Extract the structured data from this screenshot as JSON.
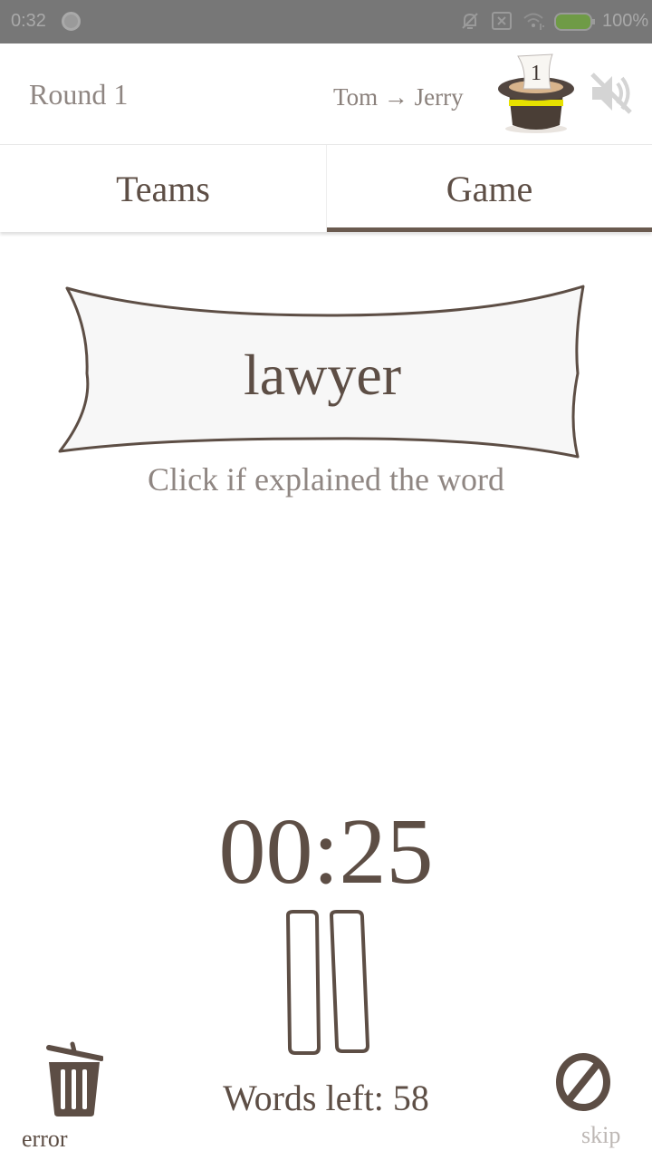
{
  "status_bar": {
    "time": "0:32",
    "battery": "100%",
    "icons": [
      "notification-dot-icon",
      "bell-off-icon",
      "sim-off-icon",
      "wifi-icon",
      "battery-charging-icon"
    ]
  },
  "header": {
    "round_label": "Round 1",
    "players": "Tom → Jerry",
    "hat_count": "1",
    "sound_icon": "volume-off-icon"
  },
  "tabs": [
    {
      "label": "Teams",
      "active": false
    },
    {
      "label": "Game",
      "active": true
    }
  ],
  "card": {
    "word": "lawyer",
    "hint": "Click if explained the word"
  },
  "timer": {
    "value": "00:25",
    "pause_icon": "pause-icon"
  },
  "footer": {
    "words_left": "Words left: 58",
    "error_label": "error",
    "skip_label": "skip"
  },
  "colors": {
    "primary": "#5d4e45",
    "muted": "#8f8682",
    "disabled": "#bdb7b4",
    "hat_band": "#e6e000"
  }
}
